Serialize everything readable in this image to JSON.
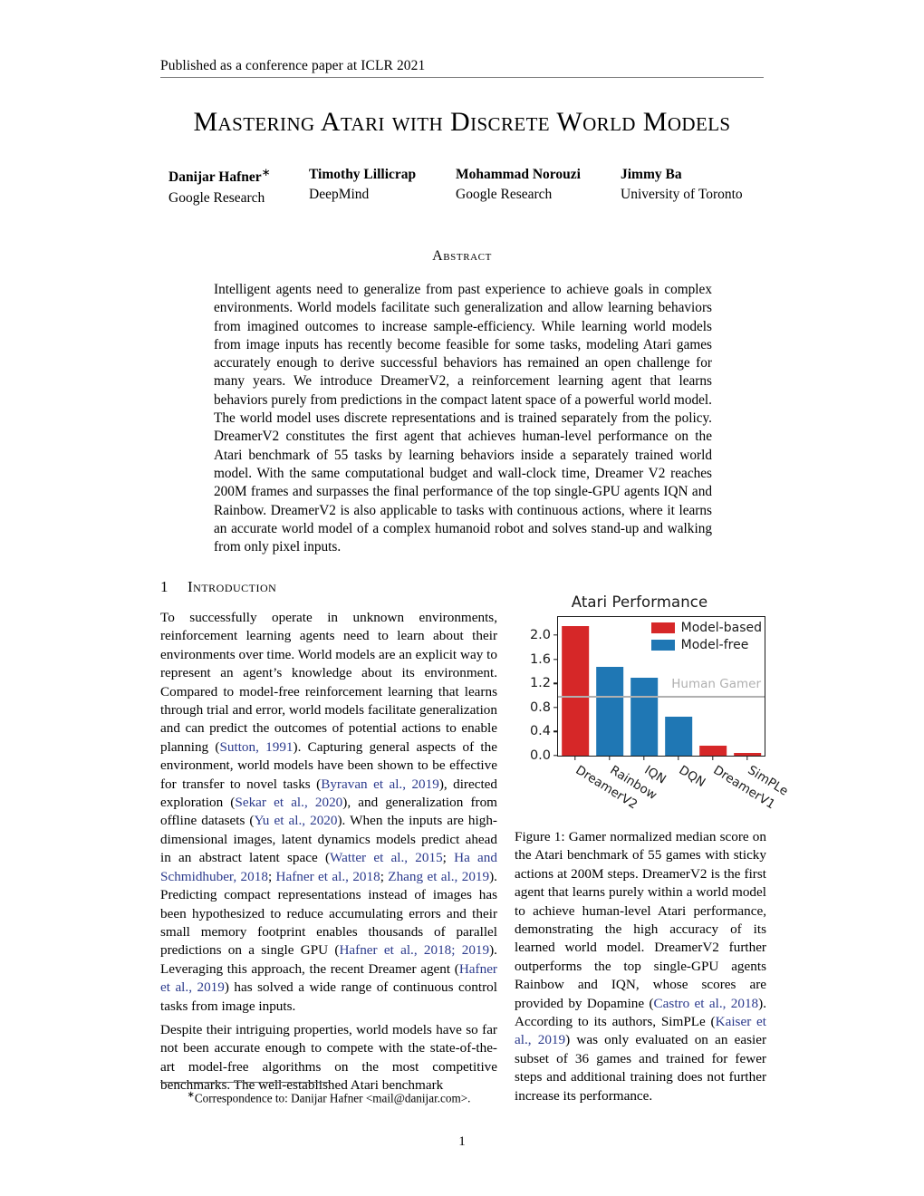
{
  "header": {
    "venue_line": "Published as a conference paper at ICLR 2021"
  },
  "title": "Mastering Atari with Discrete World Models",
  "authors": [
    {
      "name": "Danijar Hafner",
      "star": "∗",
      "affiliation": "Google Research"
    },
    {
      "name": "Timothy Lillicrap",
      "star": "",
      "affiliation": "DeepMind"
    },
    {
      "name": "Mohammad Norouzi",
      "star": "",
      "affiliation": "Google Research"
    },
    {
      "name": "Jimmy Ba",
      "star": "",
      "affiliation": "University of Toronto"
    }
  ],
  "abstract": {
    "heading": "Abstract",
    "body": "Intelligent agents need to generalize from past experience to achieve goals in complex environments. World models facilitate such generalization and allow learning behaviors from imagined outcomes to increase sample-efficiency. While learning world models from image inputs has recently become feasible for some tasks, modeling Atari games accurately enough to derive successful behaviors has remained an open challenge for many years. We introduce DreamerV2, a reinforcement learning agent that learns behaviors purely from predictions in the compact latent space of a powerful world model. The world model uses discrete representations and is trained separately from the policy. DreamerV2 constitutes the first agent that achieves human-level performance on the Atari benchmark of 55 tasks by learning behaviors inside a separately trained world model. With the same computational budget and wall-clock time, Dreamer V2 reaches 200M frames and surpasses the final performance of the top single-GPU agents IQN and Rainbow. DreamerV2 is also applicable to tasks with continuous actions, where it learns an accurate world model of a complex humanoid robot and solves stand-up and walking from only pixel inputs."
  },
  "section": {
    "number": "1",
    "heading": "Introduction"
  },
  "body_left": {
    "para1_a": "To successfully operate in unknown environments, reinforcement learning agents need to learn about their environments over time. World models are an explicit way to represent an agent’s knowledge about its environment. Compared to model-free reinforcement learning that learns through trial and error, world models facilitate generalization and can predict the outcomes of potential actions to enable planning (",
    "cite_sutton": "Sutton, 1991",
    "para1_b": "). Capturing general aspects of the environment, world models have been shown to be effective for transfer to novel tasks (",
    "cite_byravan": "Byravan et al., 2019",
    "para1_c": "), directed exploration (",
    "cite_sekar": "Sekar et al., 2020",
    "para1_d": "), and generalization from offline datasets (",
    "cite_yu": "Yu et al., 2020",
    "para1_e": "). When the inputs are high-dimensional images, latent dynamics models predict ahead in an abstract latent space (",
    "cite_watter": "Watter et al., 2015",
    "sep1": "; ",
    "cite_ha": "Ha and Schmidhuber, 2018",
    "sep2": "; ",
    "cite_hafner2018": "Hafner et al., 2018",
    "sep3": "; ",
    "cite_zhang": "Zhang et al., 2019",
    "para1_f": "). Predicting compact representations instead of images has been hypothesized to reduce accumulating errors and their small memory footprint enables thousands of parallel predictions on a single GPU (",
    "cite_hafner_20182019": "Hafner et al., 2018; 2019",
    "para1_g": "). Leveraging this approach, the recent Dreamer agent (",
    "cite_hafner2019": "Hafner et al., 2019",
    "para1_h": ") has solved a wide range of continuous control tasks from image inputs.",
    "para2": "Despite their intriguing properties, world models have so far not been accurate enough to compete with the state-of-the-art model-free algorithms on the most competitive benchmarks. The well-established Atari benchmark"
  },
  "figure_caption": {
    "part_a": "Figure 1: Gamer normalized median score on the Atari benchmark of 55 games with sticky actions at 200M steps. DreamerV2 is the first agent that learns purely within a world model to achieve human-level Atari performance, demonstrating the high accuracy of its learned world model. DreamerV2 further outperforms the top single-GPU agents Rainbow and IQN, whose scores are provided by Dopamine (",
    "cite_castro": "Castro et al., 2018",
    "part_b": "). According to its authors, SimPLe (",
    "cite_kaiser": "Kaiser et al., 2019",
    "part_c": ") was only evaluated on an easier subset of 36 games and trained for fewer steps and additional training does not further increase its performance."
  },
  "footnote": {
    "star": "∗",
    "text": "Correspondence to: Danijar Hafner <mail@danijar.com>."
  },
  "page_number": "1",
  "colors": {
    "model_based": "#d62728",
    "model_free": "#1f77b4",
    "human_gamer_line": "#b0b0b0",
    "citation_link": "#2b3a8c",
    "axis": "#1a1a1a"
  },
  "chart_data": {
    "type": "bar",
    "title": "Atari Performance",
    "xlabel": "",
    "ylabel": "",
    "categories": [
      "DreamerV2",
      "Rainbow",
      "IQN",
      "DQN",
      "DreamerV1",
      "SimPLe"
    ],
    "values": [
      2.15,
      1.47,
      1.29,
      0.65,
      0.16,
      0.05
    ],
    "bar_groups": [
      "Model-based",
      "Model-free",
      "Model-free",
      "Model-free",
      "Model-based",
      "Model-based"
    ],
    "bar_colors": [
      "#d62728",
      "#1f77b4",
      "#1f77b4",
      "#1f77b4",
      "#d62728",
      "#d62728"
    ],
    "ylim": [
      0.0,
      2.3
    ],
    "yticks": [
      "0.0",
      "0.4",
      "0.8",
      "1.2",
      "1.6",
      "2.0"
    ],
    "ytick_values": [
      0.0,
      0.4,
      0.8,
      1.2,
      1.6,
      2.0
    ],
    "grid": false,
    "legend_position": "upper right",
    "legend": [
      {
        "label": "Model-based",
        "color": "#d62728"
      },
      {
        "label": "Model-free",
        "color": "#1f77b4"
      }
    ],
    "annotations": [
      {
        "type": "hline",
        "label": "Human Gamer",
        "value": 1.0,
        "color": "#b0b0b0"
      }
    ]
  }
}
